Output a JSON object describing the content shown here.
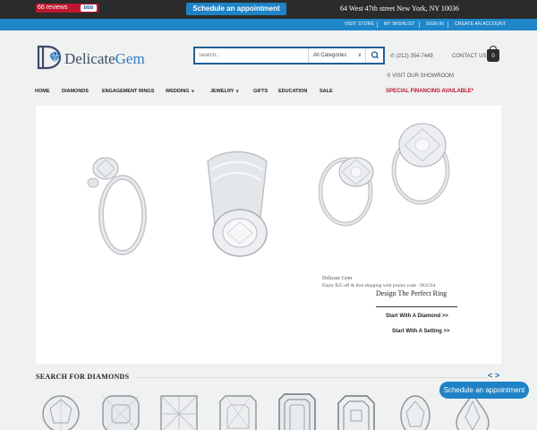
{
  "topbar": {
    "reviews_label": "66 reviews",
    "bbb_label": "bbb",
    "appointment_label": "Schedule an appointment",
    "address": "64 West 47th street New York, NY 10036"
  },
  "utility_links": [
    "VISIT STORE",
    "MY WISHLIST",
    "SIGN IN",
    "CREATE AN ACCOUNT"
  ],
  "header": {
    "logo_main": "Delicate",
    "logo_accent": "Gem",
    "search_placeholder": "Search...",
    "category_selected": "All Categories",
    "phone": "(212) 354-7449",
    "contact_label": "CONTACT US",
    "cart_count": "0",
    "showroom_label": "VISIT OUR SHOWROOM"
  },
  "nav": {
    "items": [
      "HOME",
      "DIAMONDS",
      "ENGAGEMENT RINGS",
      "WEDDING",
      "JEWELRY",
      "GIFTS",
      "EDUCATION",
      "SALE"
    ],
    "special": "SPECIAL FINANCING AVAILABLE*"
  },
  "hero": {
    "brand": "Delicate Gem",
    "promo_text": "Enjoy $25 off & free shipping with promo code : DGC64",
    "title": "Design The Perfect Ring",
    "cta_diamond": "Start With A Diamond >>",
    "cta_setting": "Start With A Setting >>"
  },
  "diamonds": {
    "title": "SEARCH FOR DIAMONDS",
    "prev": "<",
    "next": ">",
    "appointment_label": "Schedule an appointment",
    "shapes": [
      "round",
      "cushion",
      "princess",
      "radiant",
      "emerald",
      "asscher",
      "oval",
      "pear"
    ]
  },
  "colors": {
    "topbar": "#2b2b2b",
    "linkbar": "#1f87c9",
    "accent_blue": "#1e83c6",
    "special_red": "#c0102a",
    "logo_navy": "#3b4c63"
  }
}
